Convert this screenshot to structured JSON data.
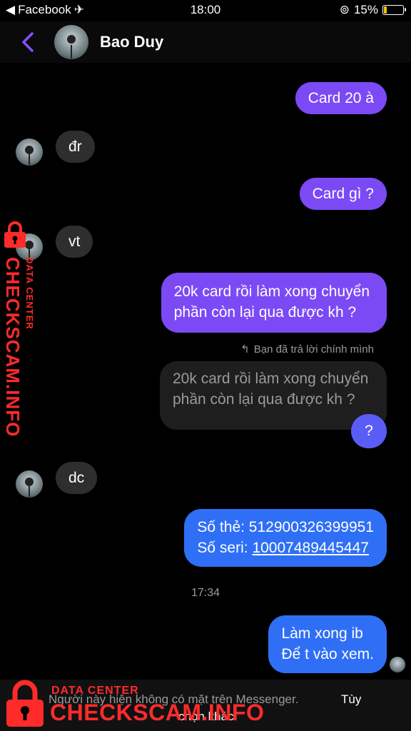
{
  "status_bar": {
    "back_app": "Facebook",
    "time": "18:00",
    "battery": "15%",
    "battery_level": 0.15
  },
  "header": {
    "contact_name": "Bao Duy"
  },
  "messages": [
    {
      "text": "Card 20 à"
    },
    {
      "text": "đr"
    },
    {
      "text": "Card gì ?"
    },
    {
      "text": "vt"
    },
    {
      "line1": "20k card rồi làm xong chuyển",
      "line2": "phần còn lại qua được kh ?"
    },
    {
      "reply_note": "Bạn đã trả lời chính mình",
      "quoted_line1": "20k card rồi làm xong chuyển",
      "quoted_line2": "phần còn lại qua được kh ?",
      "text": "?"
    },
    {
      "text": "dc"
    },
    {
      "line1_label": "Số thẻ: ",
      "line1_value": "512900326399951",
      "line2_label": "Số seri: ",
      "line2_value": "10007489445447"
    },
    {
      "line1": "Làm xong ib",
      "line2": "Để  t vào xem."
    }
  ],
  "timestamp": "17:34",
  "footer": {
    "status_text": "Người này hiện không có mặt trên Messenger.",
    "action": "Tùy",
    "action_sub": "chọn khác"
  },
  "watermark": {
    "small": "DATA CENTER",
    "big": "CHECKSCAM.INFO"
  },
  "colors": {
    "purple": "#7b4af5",
    "blue": "#2f6ff5",
    "incoming": "#2e2e2e",
    "watermark": "#ff2b2b"
  }
}
